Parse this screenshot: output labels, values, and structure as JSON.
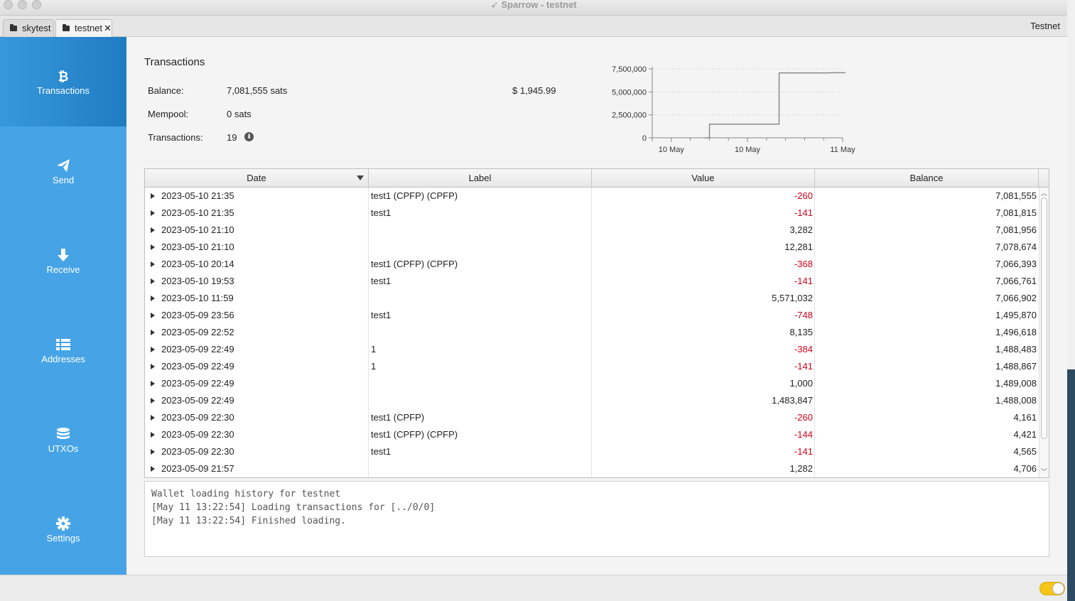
{
  "window": {
    "title": "Sparrow - testnet"
  },
  "tabs": [
    {
      "label": "skytest",
      "active": false
    },
    {
      "label": "testnet",
      "active": true,
      "close": "✕"
    }
  ],
  "network": "Testnet",
  "sidebar": {
    "items": [
      {
        "label": "Transactions",
        "icon": "bitcoin-icon",
        "active": true
      },
      {
        "label": "Send",
        "icon": "send-icon"
      },
      {
        "label": "Receive",
        "icon": "arrow-down-icon"
      },
      {
        "label": "Addresses",
        "icon": "list-icon"
      },
      {
        "label": "UTXOs",
        "icon": "coins-icon"
      },
      {
        "label": "Settings",
        "icon": "gear-icon"
      }
    ]
  },
  "summary": {
    "title": "Transactions",
    "balance_label": "Balance:",
    "balance_value": "7,081,555 sats",
    "fiat_value": "$ 1,945.99",
    "mempool_label": "Mempool:",
    "mempool_value": "0 sats",
    "tx_label": "Transactions:",
    "tx_count": "19",
    "download_icon": "download-icon"
  },
  "chart_data": {
    "type": "line",
    "step": true,
    "title": "",
    "xlabel": "",
    "ylabel": "",
    "ylim": [
      0,
      7500000
    ],
    "y_ticks": [
      "7,500,000",
      "5,000,000",
      "2,500,000",
      "0"
    ],
    "x_ticks": [
      "10 May",
      "10 May",
      "11 May"
    ],
    "grid": true,
    "series": [
      {
        "points": [
          {
            "x": "2023-05-09 21:57",
            "y": 4706
          },
          {
            "x": "2023-05-09 22:49",
            "y": 1488008
          },
          {
            "x": "2023-05-10 11:59",
            "y": 7066902
          },
          {
            "x": "2023-05-10 21:35",
            "y": 7081555
          }
        ]
      }
    ]
  },
  "table": {
    "columns": [
      "Date",
      "Label",
      "Value",
      "Balance"
    ],
    "rows": [
      {
        "date": "2023-05-10 21:35",
        "label": "test1 (CPFP) (CPFP)",
        "value": "-260",
        "balance": "7,081,555",
        "neg": true
      },
      {
        "date": "2023-05-10 21:35",
        "label": "test1",
        "value": "-141",
        "balance": "7,081,815",
        "neg": true
      },
      {
        "date": "2023-05-10 21:10",
        "label": "",
        "value": "3,282",
        "balance": "7,081,956",
        "neg": false
      },
      {
        "date": "2023-05-10 21:10",
        "label": "",
        "value": "12,281",
        "balance": "7,078,674",
        "neg": false
      },
      {
        "date": "2023-05-10 20:14",
        "label": "test1 (CPFP) (CPFP)",
        "value": "-368",
        "balance": "7,066,393",
        "neg": true
      },
      {
        "date": "2023-05-10 19:53",
        "label": "test1",
        "value": "-141",
        "balance": "7,066,761",
        "neg": true
      },
      {
        "date": "2023-05-10 11:59",
        "label": "",
        "value": "5,571,032",
        "balance": "7,066,902",
        "neg": false
      },
      {
        "date": "2023-05-09 23:56",
        "label": "test1",
        "value": "-748",
        "balance": "1,495,870",
        "neg": true
      },
      {
        "date": "2023-05-09 22:52",
        "label": "",
        "value": "8,135",
        "balance": "1,496,618",
        "neg": false
      },
      {
        "date": "2023-05-09 22:49",
        "label": "1",
        "value": "-384",
        "balance": "1,488,483",
        "neg": true
      },
      {
        "date": "2023-05-09 22:49",
        "label": "1",
        "value": "-141",
        "balance": "1,488,867",
        "neg": true
      },
      {
        "date": "2023-05-09 22:49",
        "label": "",
        "value": "1,000",
        "balance": "1,489,008",
        "neg": false
      },
      {
        "date": "2023-05-09 22:49",
        "label": "",
        "value": "1,483,847",
        "balance": "1,488,008",
        "neg": false
      },
      {
        "date": "2023-05-09 22:30",
        "label": "test1 (CPFP)",
        "value": "-260",
        "balance": "4,161",
        "neg": true
      },
      {
        "date": "2023-05-09 22:30",
        "label": "test1 (CPFP) (CPFP)",
        "value": "-144",
        "balance": "4,421",
        "neg": true
      },
      {
        "date": "2023-05-09 22:30",
        "label": "test1",
        "value": "-141",
        "balance": "4,565",
        "neg": true
      },
      {
        "date": "2023-05-09 21:57",
        "label": "",
        "value": "1,282",
        "balance": "4,706",
        "neg": false
      }
    ]
  },
  "log": {
    "lines": [
      "Wallet loading history for testnet",
      "[May 11 13:22:54] Loading transactions for [../0/0]",
      "[May 11 13:22:54] Finished loading."
    ]
  },
  "colors": {
    "sidebar": "#46a4e6",
    "sidebar_active": "#1f7cc3",
    "negative": "#d0021b",
    "toggle": "#f5c518"
  }
}
